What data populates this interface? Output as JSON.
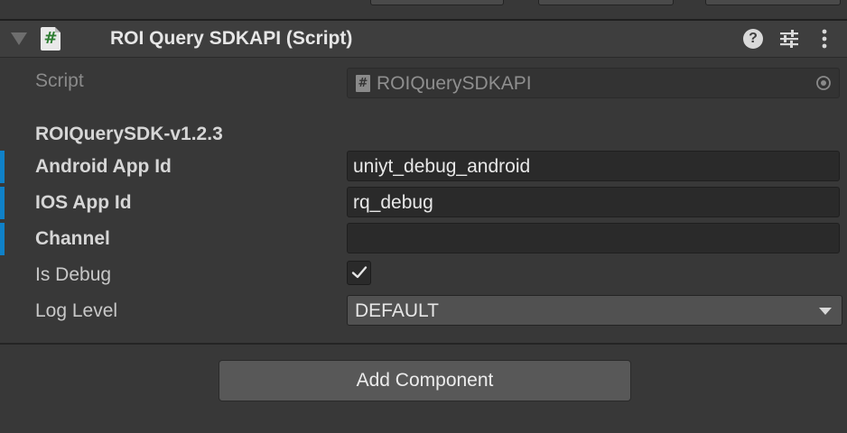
{
  "component": {
    "title": "ROI Query SDKAPI (Script)",
    "icons": {
      "foldout": "foldout-triangle-icon",
      "script": "csharp-script-icon",
      "help": "help-icon",
      "settings": "presets-sliders-icon",
      "more": "more-vertical-icon"
    },
    "help_glyph": "?",
    "script_glyph": "#"
  },
  "fields": {
    "script": {
      "label": "Script",
      "value": "ROIQuerySDKAPI",
      "icon_glyph": "#"
    },
    "version_header": "ROIQuerySDK-v1.2.3",
    "android_app_id": {
      "label": "Android App Id",
      "value": "uniyt_debug_android"
    },
    "ios_app_id": {
      "label": "IOS App Id",
      "value": "rq_debug"
    },
    "channel": {
      "label": "Channel",
      "value": ""
    },
    "is_debug": {
      "label": "Is Debug",
      "checked": true
    },
    "log_level": {
      "label": "Log Level",
      "value": "DEFAULT"
    }
  },
  "footer": {
    "add_component_label": "Add Component"
  },
  "colors": {
    "background": "#383838",
    "header": "#3e3e3e",
    "field": "#2a2a2a",
    "modified_bar": "#0f81c8",
    "script_icon_hash": "#2e7d32"
  }
}
